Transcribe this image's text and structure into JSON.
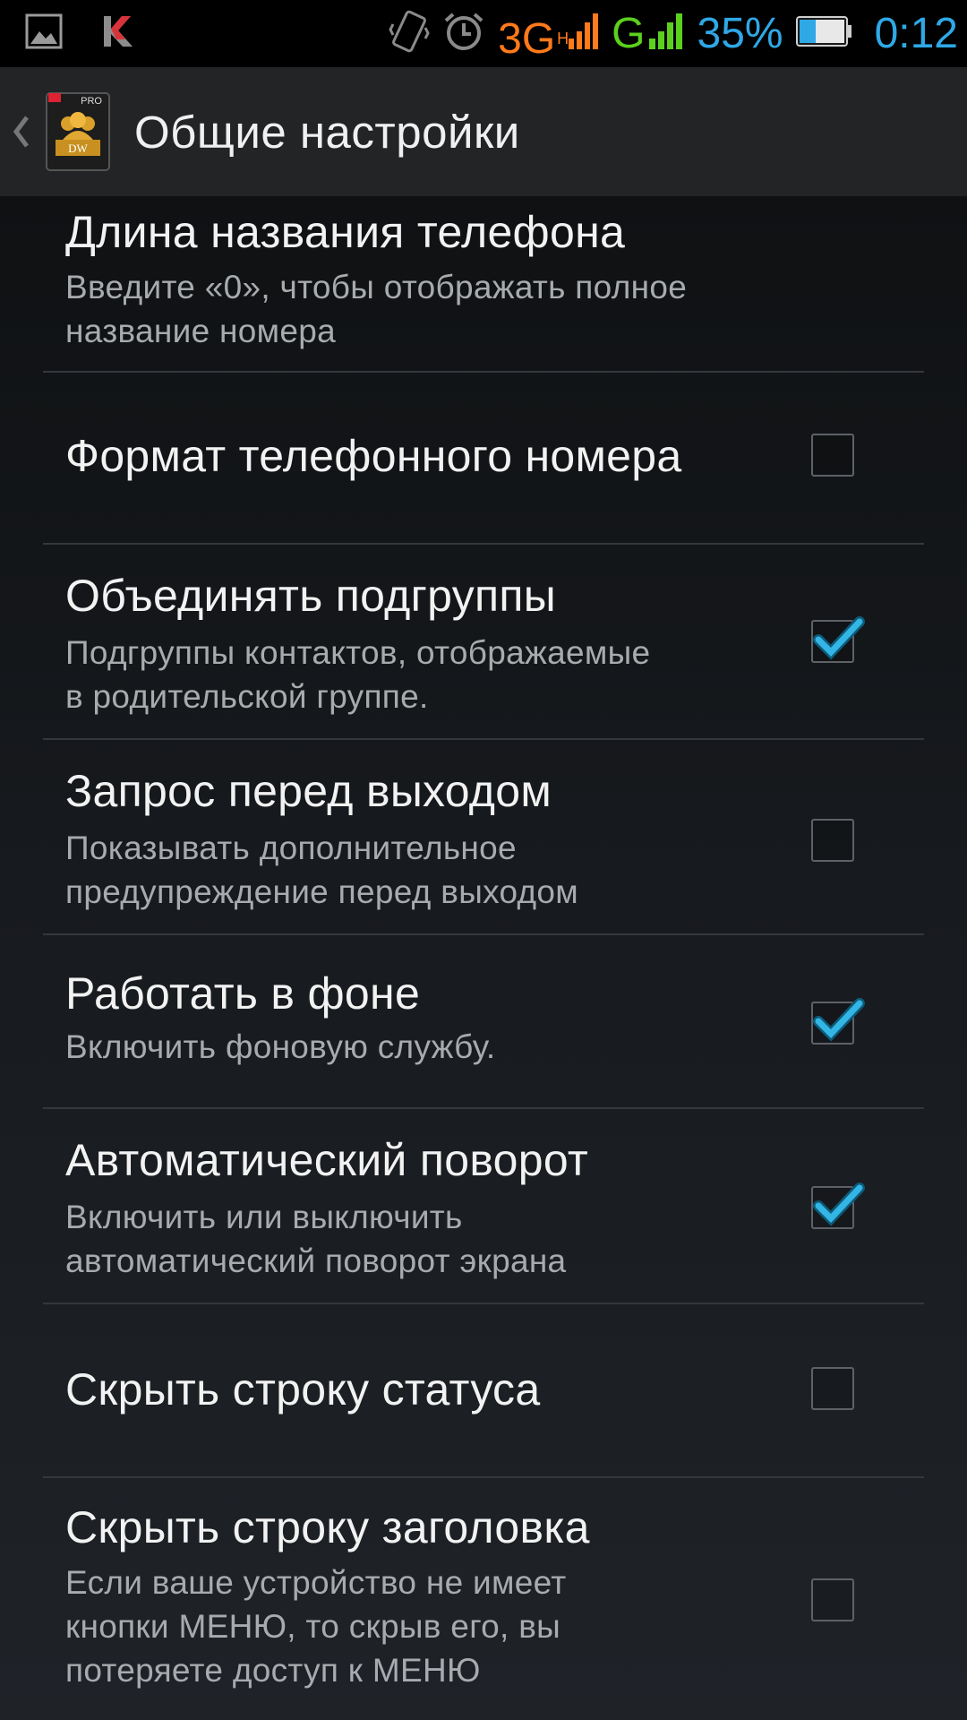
{
  "status_bar": {
    "network_3g": "3G",
    "network_3g_sub": "H",
    "network_g": "G",
    "battery_percent": "35%",
    "clock": "0:12",
    "icons": [
      "gallery-icon",
      "kaspersky-icon",
      "vibrate-icon",
      "alarm-icon",
      "signal-icon",
      "battery-icon"
    ]
  },
  "action_bar": {
    "title": "Общие настройки",
    "app_icon_label": "DW",
    "app_icon_badge": "PRO"
  },
  "colors": {
    "accent": "#33b5e5",
    "network_3g": "#ff7a1a",
    "network_g": "#5bd01e",
    "status_blue": "#2fa8e6"
  },
  "preferences": [
    {
      "title": "Длина названия телефона",
      "summary": "Введите «0», чтобы отображать полное\nназвание номера",
      "has_checkbox": false
    },
    {
      "title": "Формат телефонного номера",
      "summary": "",
      "has_checkbox": true,
      "checked": false
    },
    {
      "title": "Объединять подгруппы",
      "summary": "Подгруппы контактов, отображаемые\nв родительской группе.",
      "has_checkbox": true,
      "checked": true
    },
    {
      "title": "Запрос перед выходом",
      "summary": "Показывать дополнительное\nпредупреждение перед выходом",
      "has_checkbox": true,
      "checked": false
    },
    {
      "title": "Работать в фоне",
      "summary": "Включить фоновую службу.",
      "has_checkbox": true,
      "checked": true
    },
    {
      "title": "Автоматический поворот",
      "summary": "Включить или выключить\nавтоматический поворот экрана",
      "has_checkbox": true,
      "checked": true
    },
    {
      "title": "Скрыть строку статуса",
      "summary": "",
      "has_checkbox": true,
      "checked": false
    },
    {
      "title": "Скрыть строку заголовка",
      "summary": "Если ваше устройство не имеет\nкнопки МЕНЮ, то скрыв его, вы\nпотеряете доступ к МЕНЮ",
      "has_checkbox": true,
      "checked": false
    }
  ]
}
